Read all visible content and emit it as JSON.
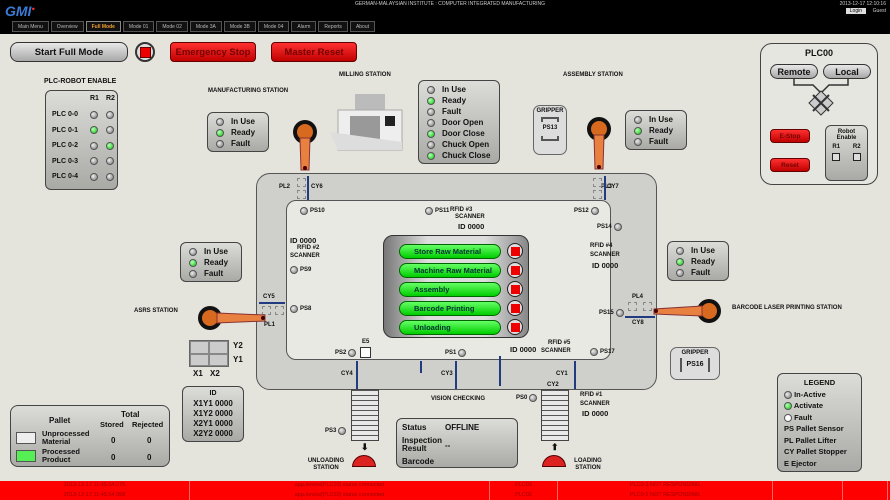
{
  "header": {
    "logo": "GMI",
    "title": "GERMAN-MALAYSIAN INSTITUTE : COMPUTER INTEGRATED MANUFACTURING",
    "datetime": "2013-12-17 12:10:16",
    "login": "Login",
    "user": "Guest"
  },
  "tabs": [
    {
      "label": "Main Menu"
    },
    {
      "label": "Overview"
    },
    {
      "label": "Full Mode",
      "active": true
    },
    {
      "label": "Mode 01"
    },
    {
      "label": "Mode 02"
    },
    {
      "label": "Mode 3A"
    },
    {
      "label": "Mode 3B"
    },
    {
      "label": "Mode 04"
    },
    {
      "label": "Alarm"
    },
    {
      "label": "Reports"
    },
    {
      "label": "About"
    }
  ],
  "controls": {
    "start": "Start Full Mode",
    "estop": "Emergency Stop",
    "reset": "Master Reset"
  },
  "plc_robot": {
    "title": "PLC-ROBOT ENABLE",
    "cols": [
      "R1",
      "R2"
    ],
    "rows": [
      {
        "label": "PLC 0-0",
        "r1": false,
        "r2": false
      },
      {
        "label": "PLC 0-1",
        "r1": true,
        "r2": false
      },
      {
        "label": "PLC 0-2",
        "r1": false,
        "r2": true
      },
      {
        "label": "PLC 0-3",
        "r1": false,
        "r2": false
      },
      {
        "label": "PLC 0-4",
        "r1": false,
        "r2": false
      }
    ]
  },
  "stations": {
    "manufacturing": "MANUFACTURING STATION",
    "milling": "MILLING STATION",
    "assembly": "ASSEMBLY STATION",
    "asrs": "ASRS STATION",
    "barcode": "BARCODE LASER PRINTING STATION",
    "unloading": "UNLOADING STATION",
    "loading": "LOADING STATION",
    "vision": "VISION CHECKING"
  },
  "status_std": [
    {
      "label": "In Use",
      "on": false
    },
    {
      "label": "Ready",
      "on": true
    },
    {
      "label": "Fault",
      "on": false
    }
  ],
  "milling_status": [
    {
      "label": "In Use",
      "on": false
    },
    {
      "label": "Ready",
      "on": true
    },
    {
      "label": "Fault",
      "on": false
    },
    {
      "label": "Door Open",
      "on": false
    },
    {
      "label": "Door Close",
      "on": true
    },
    {
      "label": "Chuck Open",
      "on": false
    },
    {
      "label": "Chuck Close",
      "on": true
    }
  ],
  "grippers": {
    "g1": {
      "title": "GRIPPER",
      "sensor": "PS13"
    },
    "g2": {
      "title": "GRIPPER",
      "sensor": "PS16"
    }
  },
  "plc00": {
    "title": "PLC00",
    "remote": "Remote",
    "local": "Local",
    "estop": "E-Stop",
    "reset": "Reset",
    "robot_enable": "Robot Enable",
    "r1": "R1",
    "r2": "R2"
  },
  "process": [
    {
      "label": "Store Raw Material"
    },
    {
      "label": "Machine Raw Material"
    },
    {
      "label": "Assembly"
    },
    {
      "label": "Barcode Printing"
    },
    {
      "label": "Unloading"
    }
  ],
  "track": {
    "PL1": "PL1",
    "PL2": "PL2",
    "PL3": "PL3",
    "PL4": "PL4",
    "CY1": "CY1",
    "CY2": "CY2",
    "CY3": "CY3",
    "CY4": "CY4",
    "CY5": "CY5",
    "CY6": "CY6",
    "CY7": "CY7",
    "CY8": "CY8",
    "E5": "E5",
    "PS0": "PS0",
    "PS1": "PS1",
    "PS2": "PS2",
    "PS3": "PS3",
    "PS8": "PS8",
    "PS9": "PS9",
    "PS10": "PS10",
    "PS11": "PS11",
    "PS12": "PS12",
    "PS14": "PS14",
    "PS15": "PS15",
    "PS17": "PS17",
    "rfid1": "RFID #1",
    "rfid2": "RFID #2",
    "rfid3": "RFID #3",
    "rfid4": "RFID #4",
    "rfid5": "RFID #5",
    "scanner": "SCANNER",
    "id": "ID 0000"
  },
  "asrs_grid": {
    "y2": "Y2",
    "y1": "Y1",
    "x1": "X1",
    "x2": "X2",
    "id_title": "ID",
    "ids": [
      "X1Y1 0000",
      "X1Y2 0000",
      "X2Y1 0000",
      "X2Y2 0000"
    ]
  },
  "pallet": {
    "title": "Pallet",
    "total": "Total",
    "stored": "Stored",
    "rejected": "Rejected",
    "rows": [
      {
        "label": "Unprocessed Material",
        "stored": "0",
        "rejected": "0"
      },
      {
        "label": "Processed Product",
        "stored": "0",
        "rejected": "0"
      }
    ]
  },
  "vision_box": {
    "status_label": "Status",
    "status": "OFFLINE",
    "inspection_label": "Inspection Result",
    "inspection": "--",
    "barcode_label": "Barcode",
    "barcode": ""
  },
  "legend": {
    "title": "LEGEND",
    "inactive": "In-Active",
    "activate": "Activate",
    "fault": "Fault",
    "ps": "PS Pallet Sensor",
    "pl": "PL Pallet Lifter",
    "cy": "CY Pallet Stopper",
    "e": "E Ejector"
  },
  "alarms": [
    {
      "time": "2013-12-17 11:45:54:375",
      "msg": "app.device[PLC03] status connected",
      "plc": "PLC03",
      "status": "PLC0-3 NOT RESPONDING"
    },
    {
      "time": "2013-12-17 11:45:54:368",
      "msg": "app.device[PLC02] status connected",
      "plc": "PLC02",
      "status": "PLC0-2 NOT RESPONDING"
    }
  ],
  "colors": {
    "alarm": "#ff0000",
    "active": "#00cc00",
    "process_button": "#33ee33",
    "stop": "#ee0000"
  }
}
